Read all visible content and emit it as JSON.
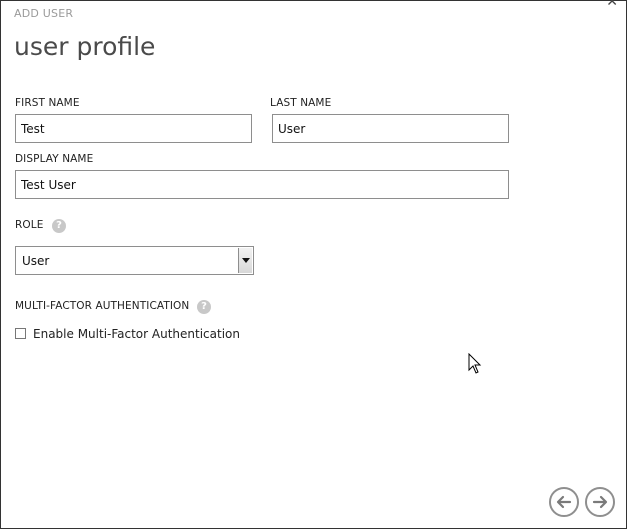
{
  "dialog": {
    "eyebrow": "ADD USER",
    "title": "user profile",
    "close_icon": "close-icon"
  },
  "form": {
    "first_name": {
      "label": "FIRST NAME",
      "value": "Test"
    },
    "last_name": {
      "label": "LAST NAME",
      "value": "User"
    },
    "display_name": {
      "label": "DISPLAY NAME",
      "value": "Test User"
    },
    "role": {
      "label": "ROLE",
      "selected": "User",
      "help_icon": "question-icon"
    },
    "mfa": {
      "label": "MULTI-FACTOR AUTHENTICATION",
      "help_icon": "question-icon",
      "checkbox_label": "Enable Multi-Factor Authentication",
      "checked": false
    }
  },
  "footer": {
    "back_icon": "arrow-left-icon",
    "next_icon": "arrow-right-icon"
  }
}
